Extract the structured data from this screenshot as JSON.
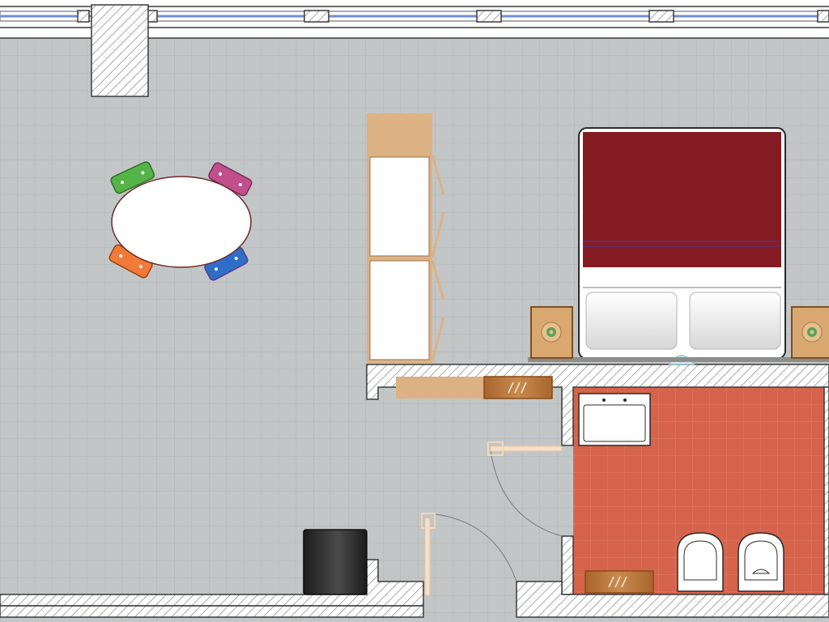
{
  "colors": {
    "floor": "#c3c6c6",
    "grid": "#b2b5b5",
    "wall_stroke": "#3a3a3a",
    "window_glass": "#6f8fd6",
    "bed_cover": "#851b22",
    "bed_stripe": "#5a2f7a",
    "wardrobe": "#dcb284",
    "bathroom_tile": "#d6634b",
    "bin": "#2b2b2b",
    "chair_green": "#55b447",
    "chair_pink": "#c14f8c",
    "chair_orange": "#f07a36",
    "chair_blue": "#2f6ec8",
    "nightstand": "#d9a870",
    "door_leaf": "#f4e0cc"
  },
  "icons": [
    "window-icon",
    "dining-table-icon",
    "chair-icon",
    "wardrobe-icon",
    "double-bed-icon",
    "pillow-icon",
    "nightstand-icon",
    "sink-icon",
    "toilet-icon",
    "bidet-icon",
    "swing-door-icon",
    "waste-bin-icon",
    "radiator-icon",
    "lamp-icon"
  ]
}
